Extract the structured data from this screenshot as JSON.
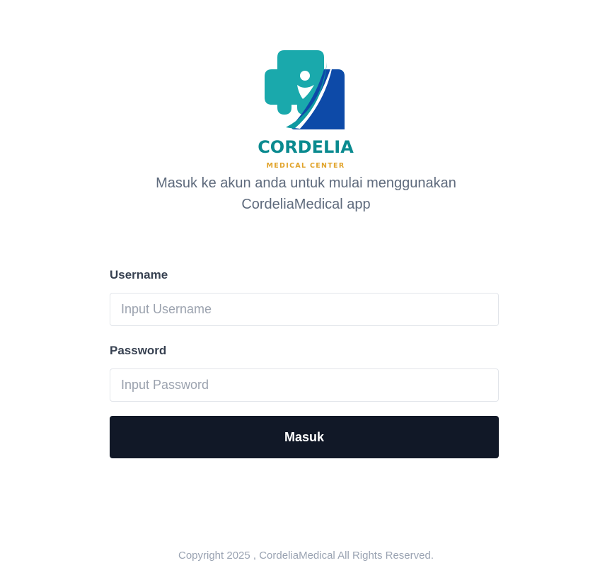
{
  "logo": {
    "name": "CORDELIA",
    "tagline": "MEDICAL CENTER",
    "colors": {
      "teal": "#0a8a8f",
      "cross": "#1aa9ac",
      "blue": "#0d4aa8",
      "gold": "#e1a32a"
    }
  },
  "subtitle": {
    "line1": "Masuk ke akun anda untuk mulai menggunakan",
    "line2": "CordeliaMedical app"
  },
  "form": {
    "username_label": "Username",
    "username_placeholder": "Input Username",
    "username_value": "",
    "password_label": "Password",
    "password_placeholder": "Input Password",
    "password_value": "",
    "submit_label": "Masuk"
  },
  "footer": {
    "copyright": "Copyright 2025 , CordeliaMedical All Rights Reserved."
  }
}
